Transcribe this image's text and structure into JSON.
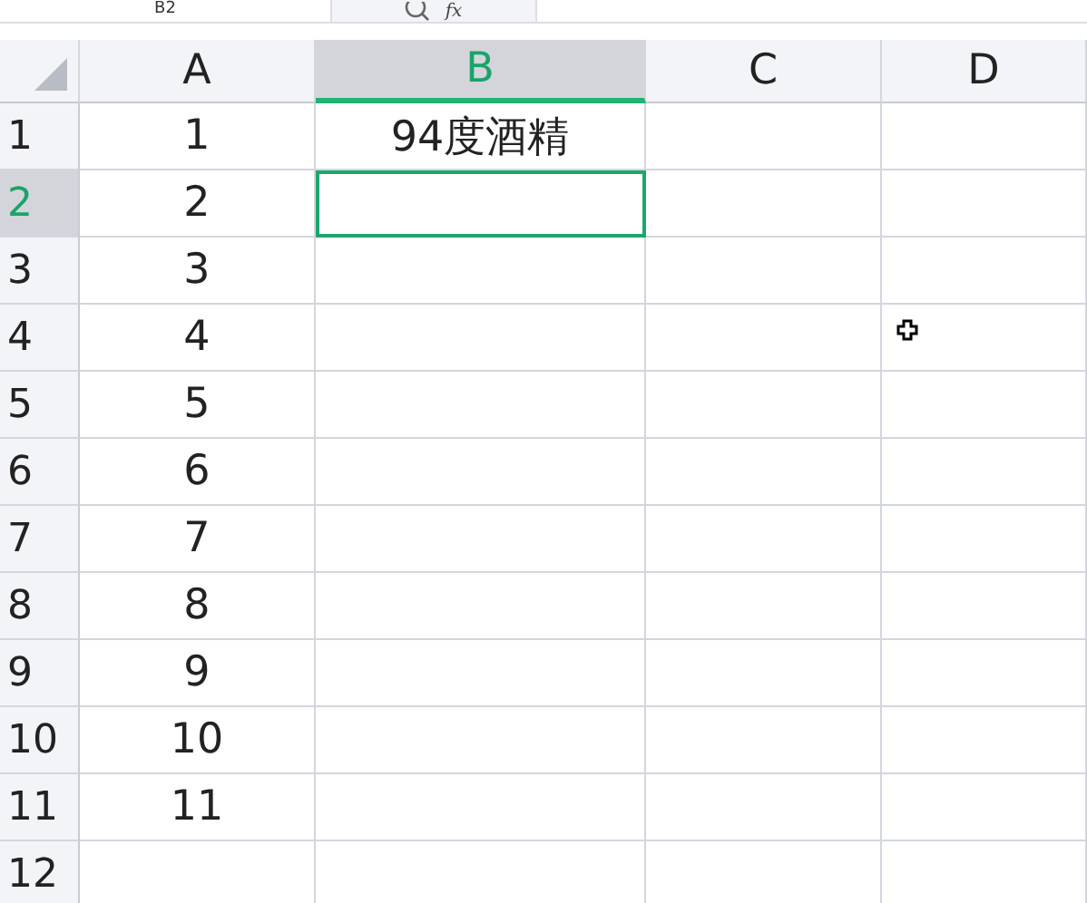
{
  "formula_bar": {
    "name_box": "B2",
    "function_label": "fx"
  },
  "columns": [
    {
      "label": "A",
      "selected": false
    },
    {
      "label": "B",
      "selected": true
    },
    {
      "label": "C",
      "selected": false
    },
    {
      "label": "D",
      "selected": false
    }
  ],
  "rows": [
    {
      "label": "1",
      "selected": false,
      "cells": [
        {
          "text": "1",
          "selected": false
        },
        {
          "text": "94度酒精",
          "selected": false
        },
        {
          "selected": false
        },
        {
          "selected": false
        }
      ]
    },
    {
      "label": "2",
      "selected": true,
      "cells": [
        {
          "text": "2",
          "selected": false
        },
        {
          "selected": true
        },
        {
          "selected": false
        },
        {
          "selected": false
        }
      ]
    },
    {
      "label": "3",
      "selected": false,
      "cells": [
        {
          "text": "3",
          "selected": false
        },
        {
          "selected": false
        },
        {
          "selected": false
        },
        {
          "selected": false
        }
      ]
    },
    {
      "label": "4",
      "selected": false,
      "cells": [
        {
          "text": "4",
          "selected": false
        },
        {
          "selected": false
        },
        {
          "selected": false
        },
        {
          "selected": false
        }
      ]
    },
    {
      "label": "5",
      "selected": false,
      "cells": [
        {
          "text": "5",
          "selected": false
        },
        {
          "selected": false
        },
        {
          "selected": false
        },
        {
          "selected": false
        }
      ]
    },
    {
      "label": "6",
      "selected": false,
      "cells": [
        {
          "text": "6",
          "selected": false
        },
        {
          "selected": false
        },
        {
          "selected": false
        },
        {
          "selected": false
        }
      ]
    },
    {
      "label": "7",
      "selected": false,
      "cells": [
        {
          "text": "7",
          "selected": false
        },
        {
          "selected": false
        },
        {
          "selected": false
        },
        {
          "selected": false
        }
      ]
    },
    {
      "label": "8",
      "selected": false,
      "cells": [
        {
          "text": "8",
          "selected": false
        },
        {
          "selected": false
        },
        {
          "selected": false
        },
        {
          "selected": false
        }
      ]
    },
    {
      "label": "9",
      "selected": false,
      "cells": [
        {
          "text": "9",
          "selected": false
        },
        {
          "selected": false
        },
        {
          "selected": false
        },
        {
          "selected": false
        }
      ]
    },
    {
      "label": "10",
      "selected": false,
      "cells": [
        {
          "text": "10",
          "selected": false
        },
        {
          "selected": false
        },
        {
          "selected": false
        },
        {
          "selected": false
        }
      ]
    },
    {
      "label": "11",
      "selected": false,
      "cells": [
        {
          "text": "11",
          "selected": false
        },
        {
          "selected": false
        },
        {
          "selected": false
        },
        {
          "selected": false
        }
      ]
    },
    {
      "label": "12",
      "selected": false,
      "cells": [
        {
          "selected": false
        },
        {
          "selected": false
        },
        {
          "selected": false
        },
        {
          "selected": false
        }
      ]
    }
  ]
}
